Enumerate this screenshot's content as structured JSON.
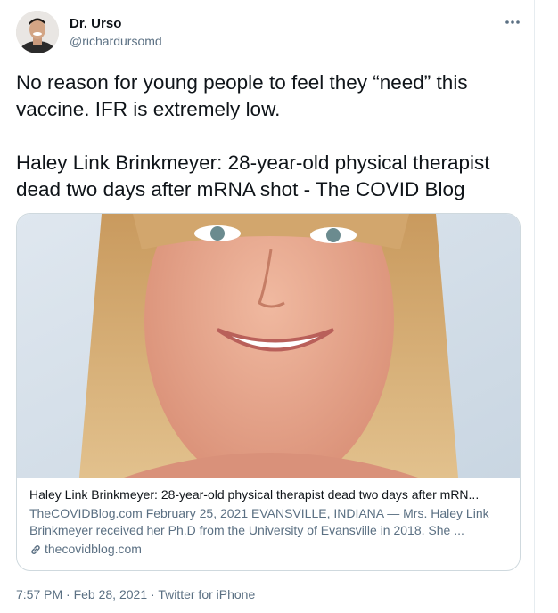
{
  "author": {
    "display_name": "Dr. Urso",
    "handle": "@richardursomd",
    "avatar_icon": "profile-photo"
  },
  "tweet": {
    "paragraph1": "No reason for young people to feel they “need” this vaccine. IFR is extremely low.",
    "paragraph2": "Haley Link Brinkmeyer: 28-year-old physical therapist dead two days after mRNA shot - The COVID Blog"
  },
  "card": {
    "title": "Haley Link Brinkmeyer: 28-year-old physical therapist dead two days after mRN...",
    "description": "TheCOVIDBlog.com February 25, 2021 EVANSVILLE, INDIANA — Mrs. Haley Link Brinkmeyer received her Ph.D from the University of Evansville in 2018. She ...",
    "domain": "thecovidblog.com",
    "image": "portrait-photo"
  },
  "meta": {
    "time": "7:57 PM",
    "separator": "·",
    "date": "Feb 28, 2021",
    "source": "Twitter for iPhone"
  },
  "colors": {
    "text": "#0f1419",
    "secondary": "#5b7083",
    "border": "#cfd9de"
  }
}
